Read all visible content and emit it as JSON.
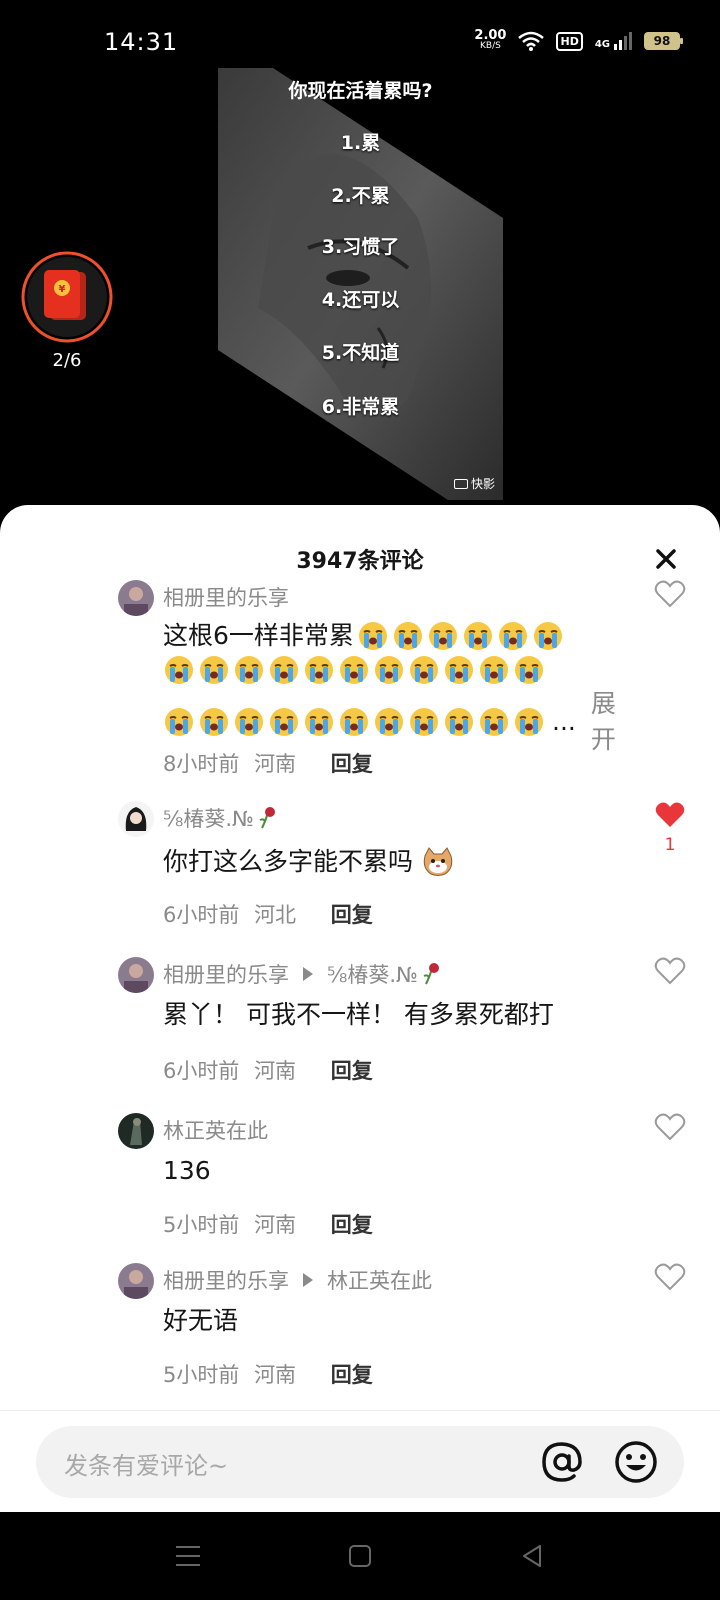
{
  "status": {
    "time": "14:31",
    "speed_value": "2.00",
    "speed_unit": "KB/S",
    "hd": "HD",
    "network": "4G",
    "battery": "98"
  },
  "video": {
    "question": "你现在活着累吗?",
    "options": [
      "1.累",
      "2.不累",
      "3.习惯了",
      "4.还可以",
      "5.不知道",
      "6.非常累"
    ],
    "watermark": "快影"
  },
  "red_packet": {
    "count": "2/6"
  },
  "comments_sheet": {
    "title": "3947条评论",
    "comments": [
      {
        "author": "相册里的乐享",
        "reply_to": "",
        "text": "这根6一样非常累",
        "emoji_count": 28,
        "expand_label": "展开",
        "ellipsis": "...",
        "time": "8小时前",
        "location": "河南",
        "reply_label": "回复",
        "liked": false,
        "like_count": ""
      },
      {
        "author": "⅝椿葵.№",
        "reply_to": "",
        "text": "你打这么多字能不累吗",
        "time": "6小时前",
        "location": "河北",
        "reply_label": "回复",
        "liked": true,
        "like_count": "1"
      },
      {
        "author": "相册里的乐享",
        "reply_to": "⅝椿葵.№",
        "text": "累丫！ 可我不一样！ 有多累死都打",
        "time": "6小时前",
        "location": "河南",
        "reply_label": "回复",
        "liked": false,
        "like_count": ""
      },
      {
        "author": "林正英在此",
        "reply_to": "",
        "text": "136",
        "time": "5小时前",
        "location": "河南",
        "reply_label": "回复",
        "liked": false,
        "like_count": ""
      },
      {
        "author": "相册里的乐享",
        "reply_to": "林正英在此",
        "text": "好无语",
        "time": "5小时前",
        "location": "河南",
        "reply_label": "回复",
        "liked": false,
        "like_count": ""
      }
    ]
  },
  "input": {
    "placeholder": "发条有爱评论~"
  },
  "colors": {
    "like_red": "#e8363b",
    "meta_gray": "#8a8a8a",
    "packet_red": "#e5301f",
    "ring_orange": "#f0502a"
  }
}
